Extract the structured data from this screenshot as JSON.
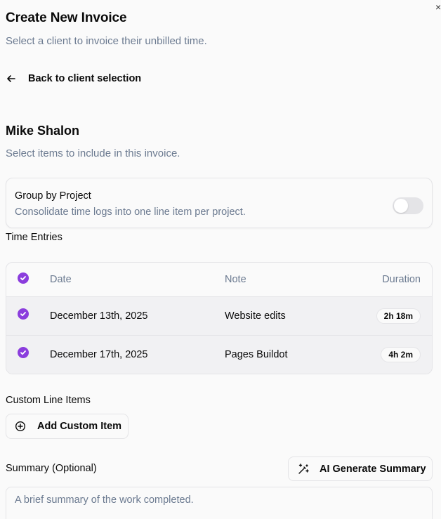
{
  "header": {
    "title": "Create New Invoice",
    "subtitle": "Select a client to invoice their unbilled time.",
    "close_icon": "x-icon"
  },
  "back_link": {
    "label": "Back to client selection",
    "icon": "arrow-left-icon"
  },
  "client": {
    "name": "Mike Shalon",
    "instruction": "Select items to include in this invoice."
  },
  "group_by_project": {
    "title": "Group by Project",
    "description": "Consolidate time logs into one line item per project.",
    "enabled": false
  },
  "time_entries": {
    "label": "Time Entries",
    "columns": {
      "date": "Date",
      "note": "Note",
      "duration": "Duration"
    },
    "all_selected": true,
    "rows": [
      {
        "selected": true,
        "date": "December 13th, 2025",
        "note": "Website edits",
        "duration": "2h 18m"
      },
      {
        "selected": true,
        "date": "December 17th, 2025",
        "note": "Pages Buildot",
        "duration": "4h 2m"
      }
    ]
  },
  "custom_line_items": {
    "label": "Custom Line Items",
    "add_button": "Add Custom Item",
    "add_icon": "plus-circle-icon"
  },
  "summary": {
    "label": "Summary (Optional)",
    "ai_button": "AI Generate Summary",
    "ai_icon": "magic-wand-icon",
    "placeholder": "A brief summary of the work completed.",
    "value": ""
  },
  "colors": {
    "accent": "#8b3ddd",
    "muted_text": "#6b7a90",
    "border": "#e4e4e7",
    "background": "#fafafa"
  }
}
